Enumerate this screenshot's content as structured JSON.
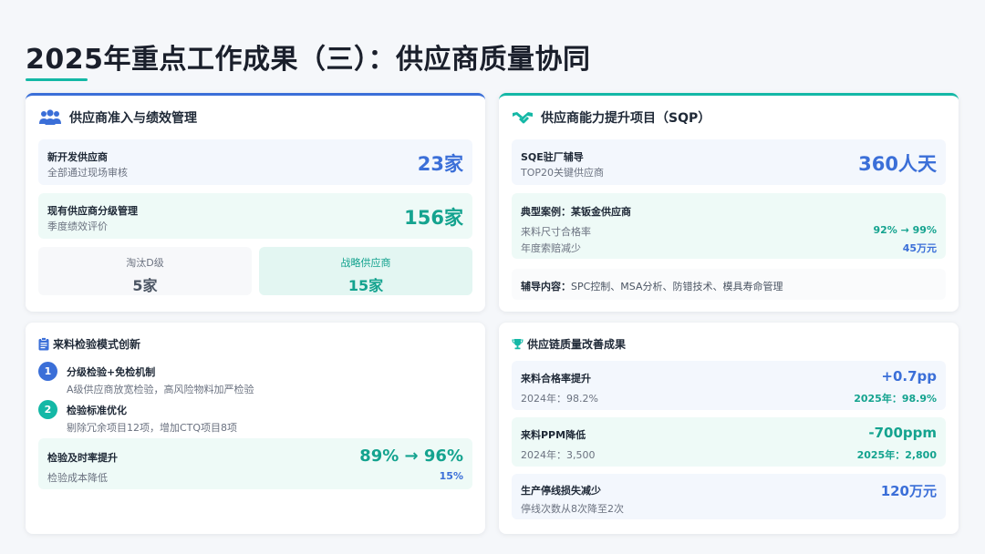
{
  "title": "2025年重点工作成果（三）：供应商质量协同",
  "cards": {
    "admission": {
      "title": "供应商准入与绩效管理",
      "rows": [
        {
          "label": "新开发供应商",
          "sub": "全部通过现场审核",
          "value": "23家"
        },
        {
          "label": "现有供应商分级管理",
          "sub": "季度绩效评价",
          "value": "156家"
        }
      ],
      "tiles": [
        {
          "label": "淘汰D级",
          "value": "5家"
        },
        {
          "label": "战略供应商",
          "value": "15家"
        }
      ]
    },
    "sqp": {
      "title": "供应商能力提升项目（SQP）",
      "row1": {
        "label": "SQE驻厂辅导",
        "sub": "TOP20关键供应商",
        "value": "360人天"
      },
      "case": {
        "label": "典型案例：某钣金供应商",
        "items": [
          {
            "label": "来料尺寸合格率",
            "value": "92% → 99%"
          },
          {
            "label": "年度索赔减少",
            "value": "45万元"
          }
        ]
      },
      "content": {
        "label": "辅导内容：",
        "text": "SPC控制、MSA分析、防错技术、模具寿命管理"
      }
    },
    "inspection": {
      "title": "来料检验模式创新",
      "steps": [
        {
          "num": "1",
          "title": "分级检验+免检机制",
          "desc": "A级供应商放宽检验，高风险物料加严检验"
        },
        {
          "num": "2",
          "title": "检验标准优化",
          "desc": "剔除冗余项目12项，增加CTQ项目8项"
        }
      ],
      "summary": {
        "label": "检验及时率提升",
        "value": "89% → 96%",
        "sub": "检验成本降低",
        "sub_value": "15%"
      }
    },
    "results": {
      "title": "供应链质量改善成果",
      "rows": [
        {
          "label": "来料合格率提升",
          "value": "+0.7pp",
          "left": "2024年：98.2%",
          "right": "2025年：98.9%"
        },
        {
          "label": "来料PPM降低",
          "value": "-700ppm",
          "left": "2024年：3,500",
          "right": "2025年：2,800"
        },
        {
          "label": "生产停线损失减少",
          "value": "120万元",
          "left": "停线次数从8次降至2次"
        }
      ]
    }
  },
  "colors": {
    "blue": "#3b6fd8",
    "teal": "#14a38f"
  }
}
